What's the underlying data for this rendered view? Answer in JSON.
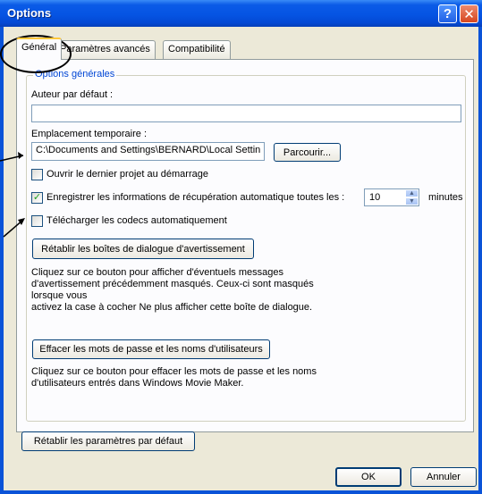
{
  "window": {
    "title": "Options",
    "help_glyph": "?",
    "close_glyph": "✕"
  },
  "tabs": [
    {
      "label": "Général",
      "active": true
    },
    {
      "label": "Paramètres avancés",
      "active": false
    },
    {
      "label": "Compatibilité",
      "active": false
    }
  ],
  "general": {
    "group_title": "Options générales",
    "author_label": "Auteur par défaut :",
    "author_value": "",
    "temp_label": "Emplacement temporaire :",
    "temp_value": "C:\\Documents and Settings\\BERNARD\\Local Settin",
    "browse_button": "Parcourir...",
    "open_last_project": {
      "label": "Ouvrir le dernier projet au démarrage",
      "checked": false
    },
    "autosave": {
      "label": "Enregistrer les informations de récupération automatique toutes les :",
      "checked": true,
      "value": "10",
      "unit": "minutes"
    },
    "download_codecs": {
      "label": "Télécharger les codecs automatiquement",
      "checked": false
    },
    "reset_warnings_button": "Rétablir les boîtes de dialogue d'avertissement",
    "reset_warnings_desc": [
      "Cliquez sur ce bouton pour afficher d'éventuels messages",
      "d'avertissement précédemment masqués. Ceux-ci sont masqués",
      "lorsque vous",
      "activez la case à cocher Ne plus afficher cette boîte de dialogue."
    ],
    "clear_passwords_button": "Effacer les mots de passe et les noms d'utilisateurs",
    "clear_passwords_desc": [
      "Cliquez sur ce bouton pour effacer les mots de passe et les noms",
      "d'utilisateurs entrés dans Windows Movie Maker."
    ]
  },
  "footer": {
    "restore_defaults_button": "Rétablir les paramètres par défaut",
    "ok_button": "OK",
    "cancel_button": "Annuler"
  },
  "colors": {
    "titlebar": "#0554e3",
    "dialog_bg": "#ece9d8",
    "group_title": "#0046d5",
    "checkmark": "#21a121"
  }
}
